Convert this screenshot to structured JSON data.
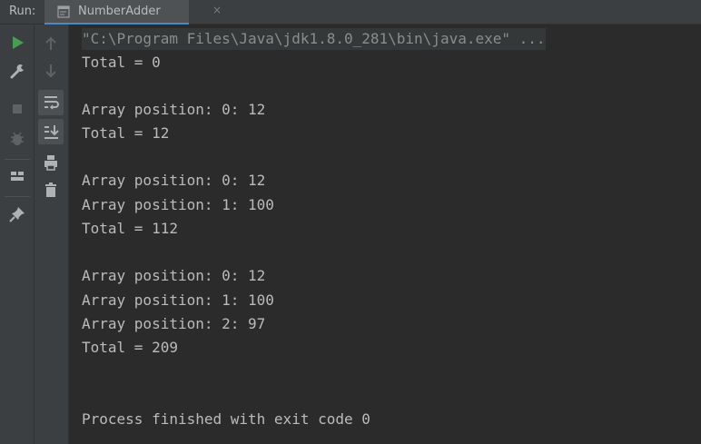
{
  "run_bar": {
    "label": "Run:",
    "tab_label": "NumberAdder",
    "close_glyph": "×"
  },
  "toolbar_left": {
    "items": [
      {
        "icon": "run-icon",
        "color": "#499c54"
      },
      {
        "icon": "wrench-icon"
      },
      {
        "icon": "stop-icon"
      },
      {
        "icon": "debug-bug-icon"
      },
      {
        "icon": "layout-icon"
      },
      {
        "icon": "pin-icon"
      }
    ]
  },
  "toolbar_right": {
    "items": [
      {
        "icon": "arrow-up-icon"
      },
      {
        "icon": "arrow-down-icon"
      },
      {
        "icon": "soft-wrap-icon"
      },
      {
        "icon": "scroll-to-end-icon"
      },
      {
        "icon": "print-icon"
      },
      {
        "icon": "trash-icon"
      }
    ]
  },
  "console": {
    "lines": [
      "\"C:\\Program Files\\Java\\jdk1.8.0_281\\bin\\java.exe\" ...",
      "Total = 0",
      "",
      "Array position: 0: 12",
      "Total = 12",
      "",
      "Array position: 0: 12",
      "Array position: 1: 100",
      "Total = 112",
      "",
      "Array position: 0: 12",
      "Array position: 1: 100",
      "Array position: 2: 97",
      "Total = 209",
      "",
      "",
      "Process finished with exit code 0"
    ]
  },
  "colors": {
    "background": "#2b2b2b",
    "panel": "#3c3f41",
    "text": "#bbbbbb",
    "accent": "#4a88c7",
    "run_green": "#499c54"
  }
}
